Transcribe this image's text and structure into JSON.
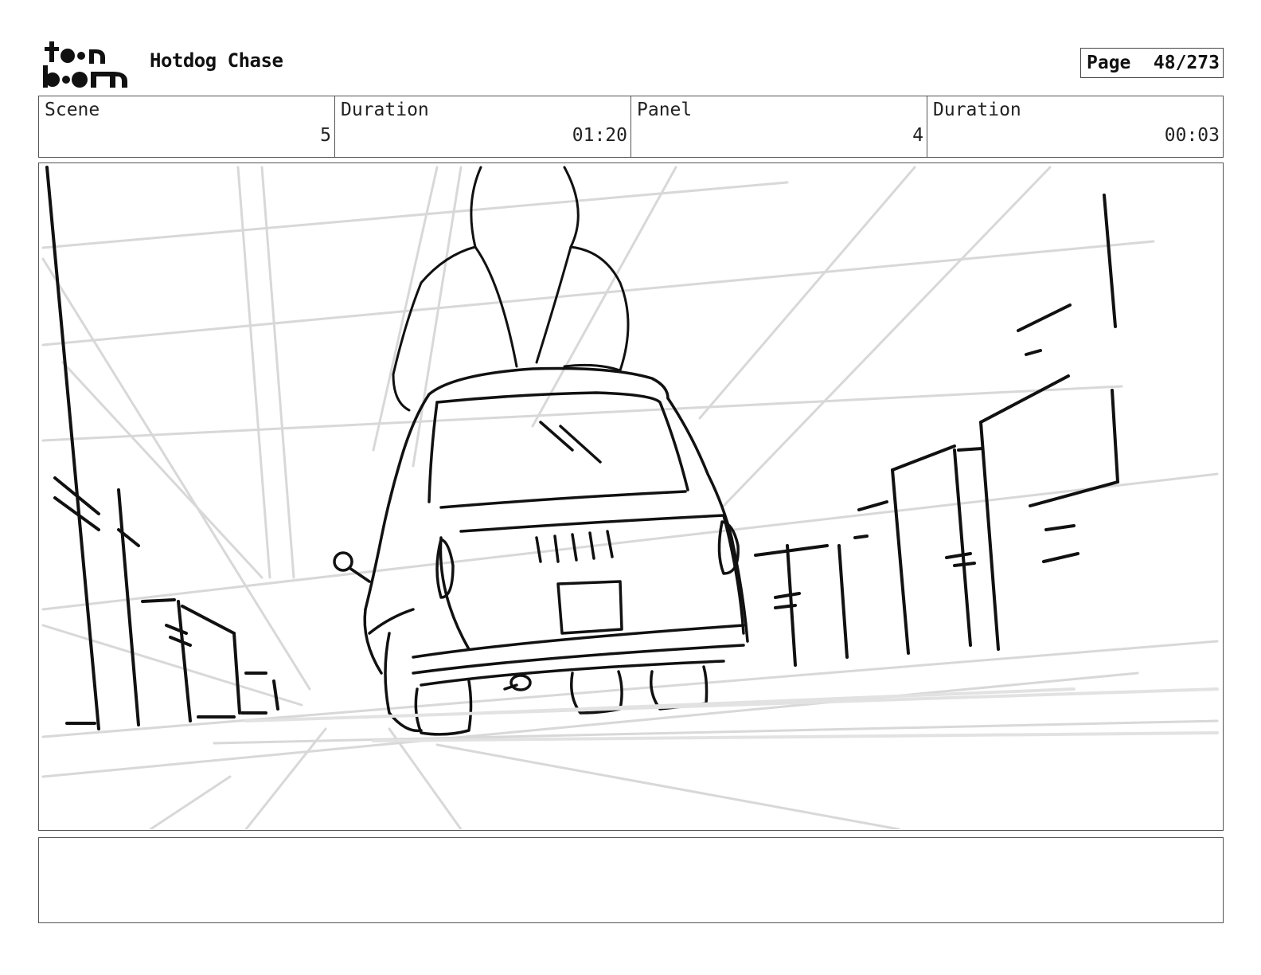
{
  "header": {
    "logo_text": "toonboom",
    "title": "Hotdog Chase",
    "page_label": "Page",
    "page_value": "48/273"
  },
  "info": {
    "scene_label": "Scene",
    "scene_value": "5",
    "scene_duration_label": "Duration",
    "scene_duration_value": "01:20",
    "panel_label": "Panel",
    "panel_value": "4",
    "panel_duration_label": "Duration",
    "panel_duration_value": "00:03"
  },
  "notes": {
    "text": ""
  }
}
